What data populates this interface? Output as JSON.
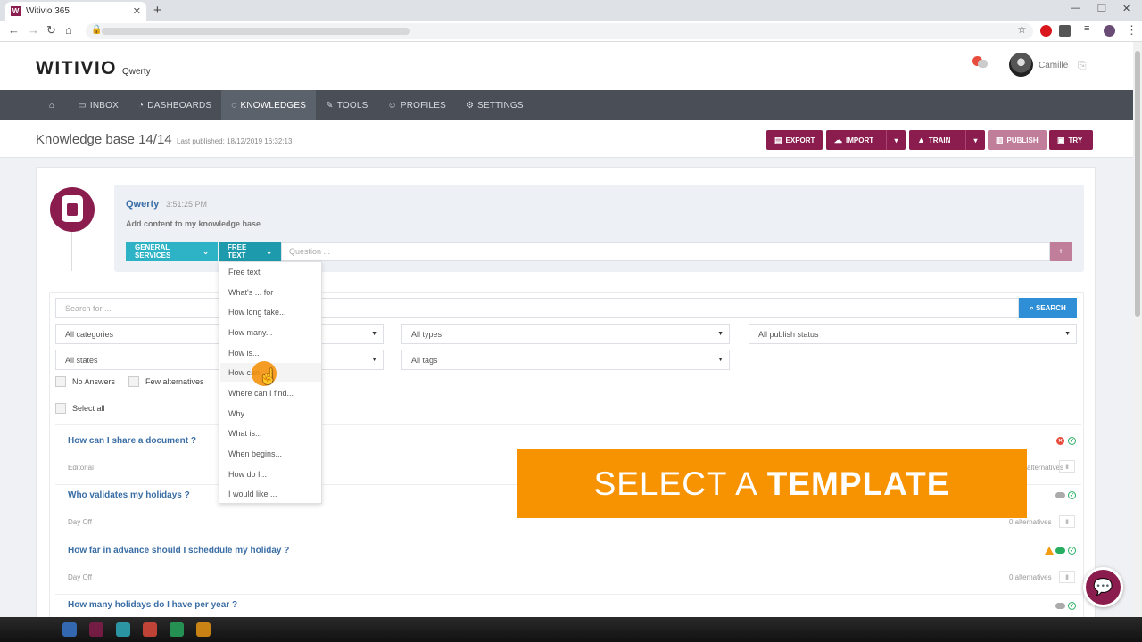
{
  "browser": {
    "tab_title": "Witivio 365",
    "tab_favicon": "W",
    "new_tab": "+",
    "close_tab": "✕"
  },
  "app": {
    "logo": "WITIVIO",
    "logo_sub": "Qwerty",
    "user": "Camille"
  },
  "nav": [
    {
      "label": "",
      "icon": "home-icon"
    },
    {
      "label": "INBOX",
      "icon": "inbox-icon"
    },
    {
      "label": "DASHBOARDS",
      "icon": "dashboard-icon"
    },
    {
      "label": "KNOWLEDGES",
      "icon": "chat-icon"
    },
    {
      "label": "TOOLS",
      "icon": "wrench-icon"
    },
    {
      "label": "PROFILES",
      "icon": "users-icon"
    },
    {
      "label": "SETTINGS",
      "icon": "gear-icon"
    }
  ],
  "page": {
    "title": "Knowledge base 14/14",
    "last_published": "Last published: 18/12/2019 16:32:13"
  },
  "actions": {
    "export": "EXPORT",
    "import": "IMPORT",
    "train": "TRAIN",
    "publish": "PUBLISH",
    "try": "TRY"
  },
  "message": {
    "name": "Qwerty",
    "time": "3:51:25 PM",
    "text": "Add content to my knowledge base"
  },
  "composer": {
    "category": "GENERAL SERVICES",
    "type": "FREE TEXT",
    "placeholder": "Question ...",
    "add": "+"
  },
  "dropdown": [
    "Free text",
    "What's ... for",
    "How long take...",
    "How many...",
    "How is...",
    "How can...",
    "Where can I find...",
    "Why...",
    "What is...",
    "When begins...",
    "How do I...",
    "I would like ..."
  ],
  "filters": {
    "search_placeholder": "Search for ...",
    "search_button": "SEARCH",
    "categories": "All categories",
    "types": "All types",
    "publish_status": "All publish status",
    "states": "All states",
    "tags": "All tags",
    "no_answers": "No Answers",
    "few_alternatives": "Few alternatives",
    "select_all": "Select all"
  },
  "rows": [
    {
      "title": "How can I share a document ?",
      "category": "Editorial",
      "alternatives": "alternatives"
    },
    {
      "title": "Who validates my holidays ?",
      "category": "Day Off",
      "alternatives": "0 alternatives"
    },
    {
      "title": "How far in advance should I scheddule my holiday ?",
      "category": "Day Off",
      "alternatives": "0 alternatives"
    },
    {
      "title": "How many holidays do I have per year ?",
      "category": "",
      "alternatives": ""
    }
  ],
  "banner": {
    "light": "SELECT A",
    "bold": "TEMPLATE"
  },
  "colors": {
    "brand": "#8a1d4e",
    "accent": "#2eb3c6",
    "banner": "#f79200",
    "nav": "#4a4f57"
  }
}
